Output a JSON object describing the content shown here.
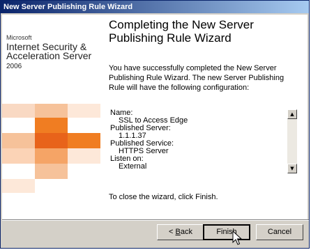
{
  "window": {
    "title": "New Server Publishing Rule Wizard"
  },
  "brand": {
    "company": "Microsoft",
    "product_line1": "Internet Security &",
    "product_line2": "Acceleration Server",
    "year": "2006"
  },
  "page": {
    "heading": "Completing the New Server Publishing Rule Wizard",
    "intro": "You have successfully completed the New Server Publishing Rule Wizard. The new Server Publishing Rule will have the following configuration:",
    "summary": [
      {
        "text": "Name:",
        "indent": false
      },
      {
        "text": "SSL to Access Edge",
        "indent": true
      },
      {
        "text": "Published Server:",
        "indent": false
      },
      {
        "text": "1.1.1.37",
        "indent": true
      },
      {
        "text": "Published Service:",
        "indent": false
      },
      {
        "text": "HTTPS Server",
        "indent": true
      },
      {
        "text": "Listen on:",
        "indent": false
      },
      {
        "text": "External",
        "indent": true
      }
    ],
    "closing": "To close the wizard, click Finish."
  },
  "buttons": {
    "back_prefix": "< ",
    "back_mnemonic": "B",
    "back_rest": "ack",
    "finish": "Finish",
    "cancel": "Cancel"
  },
  "icons": {
    "scroll_up": "scroll-up-arrow",
    "scroll_down": "scroll-down-arrow",
    "cursor": "mouse-pointer"
  },
  "colors": {
    "titlebar_start": "#0a246a",
    "titlebar_end": "#a6caf0",
    "tile_orange": "#f07d22",
    "tile_light": "#f6c29a"
  }
}
